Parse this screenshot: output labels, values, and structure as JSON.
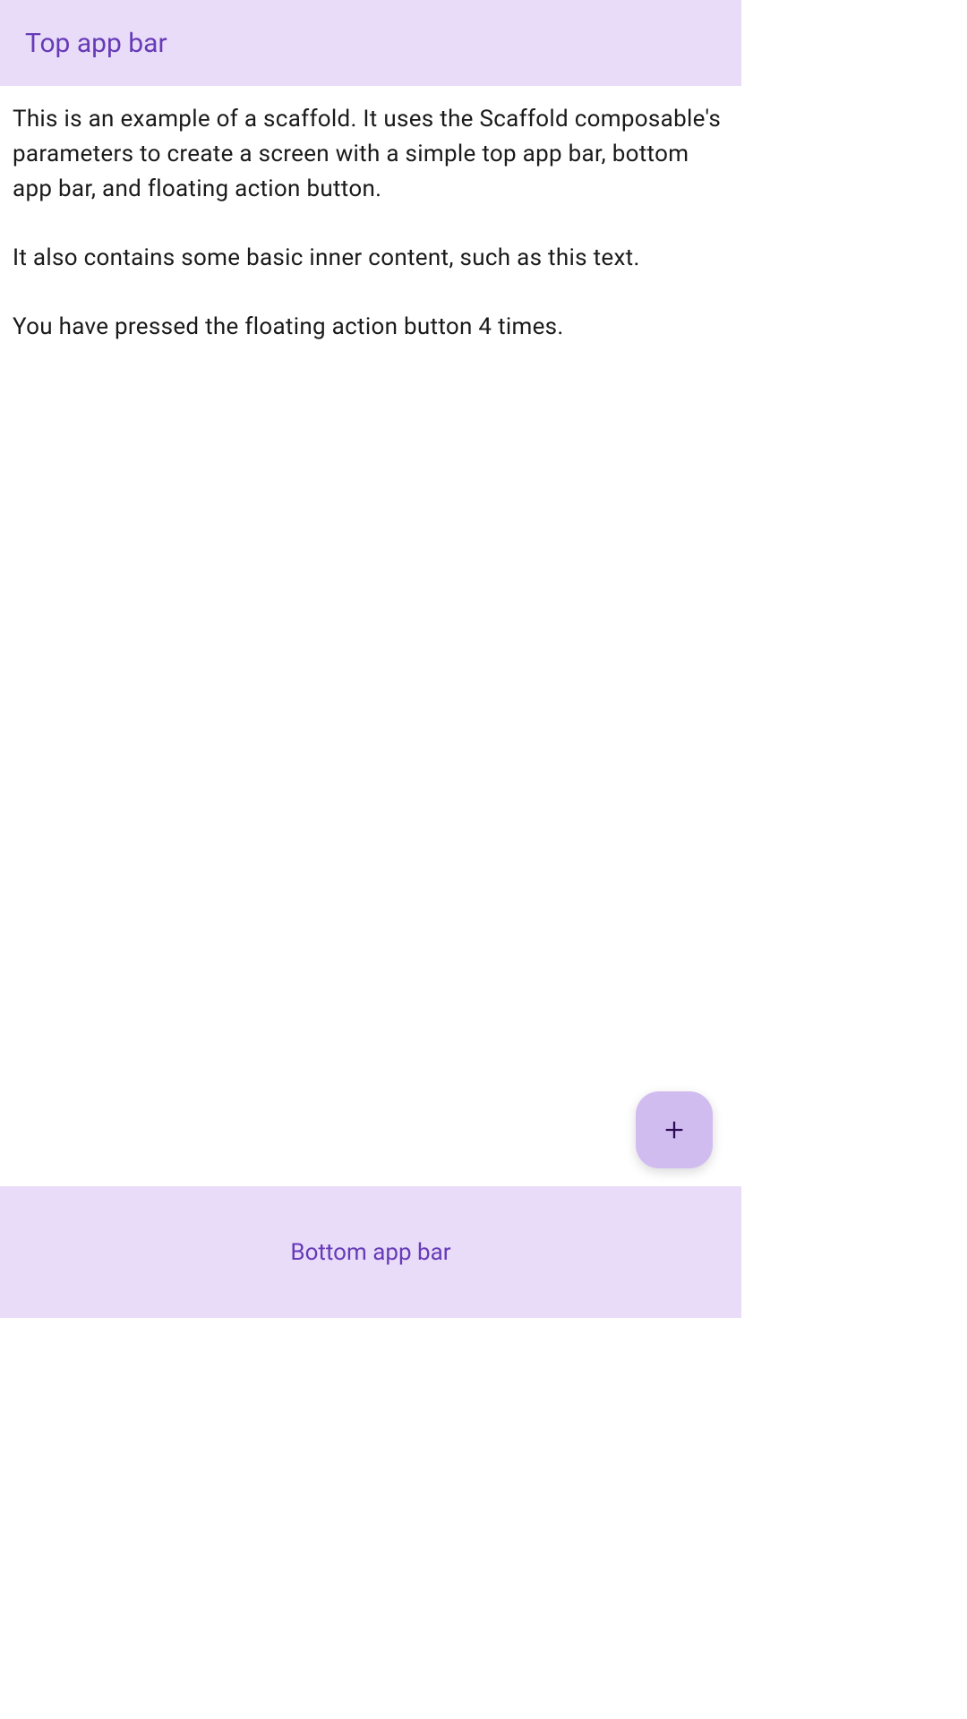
{
  "topBar": {
    "title": "Top app bar"
  },
  "content": {
    "paragraph1": "This is an example of a scaffold. It uses the Scaffold composable's parameters to create a screen with a simple top app bar, bottom app bar, and floating action button.",
    "paragraph2": "It also contains some basic inner content, such as this text.",
    "paragraph3": "You have pressed the floating action button 4 times."
  },
  "fab": {
    "pressCount": 4
  },
  "bottomBar": {
    "label": "Bottom app bar"
  },
  "colors": {
    "barBackground": "#e8dcf8",
    "barText": "#673ab7",
    "fabBackground": "#d1bcf0",
    "fabIcon": "#2d0c57"
  }
}
